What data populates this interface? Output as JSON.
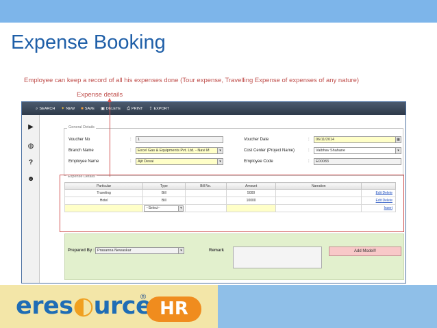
{
  "slide": {
    "title": "Expense Booking",
    "subtitle": "Employee can keep a record of all his expenses done (Tour expense, Travelling Expense of expenses of any nature)",
    "callout": "Expense details"
  },
  "toolbar": {
    "search": "SEARCH",
    "new": "NEW",
    "save": "SAVE",
    "delete": "DELETE",
    "print": "PRINT",
    "export": "EXPORT"
  },
  "general": {
    "legend": "General Details",
    "voucher_no_label": "Voucher No",
    "voucher_no_value": "1",
    "branch_label": "Branch Name",
    "branch_value": "Excel Gas & Equipments Pvt. Ltd. - Navi M",
    "employee_label": "Employee Name",
    "employee_value": "Ajit Desai",
    "voucher_date_label": "Voucher Date",
    "voucher_date_value": "06/11/2014",
    "cost_center_label": "Cost Center (Project Name)",
    "cost_center_value": "Vaibhav Shahane",
    "employee_code_label": "Employee Code",
    "employee_code_value": "E00083",
    "colon": ":"
  },
  "expense": {
    "legend": "Expense Details",
    "columns": [
      "Particular",
      "Type",
      "Bill No.",
      "Amount",
      "Narration"
    ],
    "rows": [
      {
        "particular": "Traveling",
        "type": "Bill",
        "bill_no": "",
        "amount": "5000",
        "narration": "",
        "edit": "Edit",
        "delete": "Delete"
      },
      {
        "particular": "Hotel",
        "type": "Bill",
        "bill_no": "",
        "amount": "10000",
        "narration": "",
        "edit": "Edit",
        "delete": "Delete"
      }
    ],
    "new_row_select": "--Select--",
    "insert": "Insert"
  },
  "footer": {
    "prepared_by_label": "Prepared By :",
    "prepared_by_value": "Prasanna Newaskar",
    "remark_label": "Remark",
    "add_model": "Add Model!!"
  },
  "logo": {
    "text_a": "eres",
    "text_b": "urce",
    "reg": "®",
    "hr": "HR"
  },
  "colors": {
    "title": "#1f5fa8",
    "accent_red": "#c0504d",
    "toolbar": "#3a4658",
    "input_yellow": "#ffffc8",
    "footer_green": "#e2f0cd",
    "logo_blue": "#1f6db5",
    "logo_orange": "#f08c1e"
  }
}
